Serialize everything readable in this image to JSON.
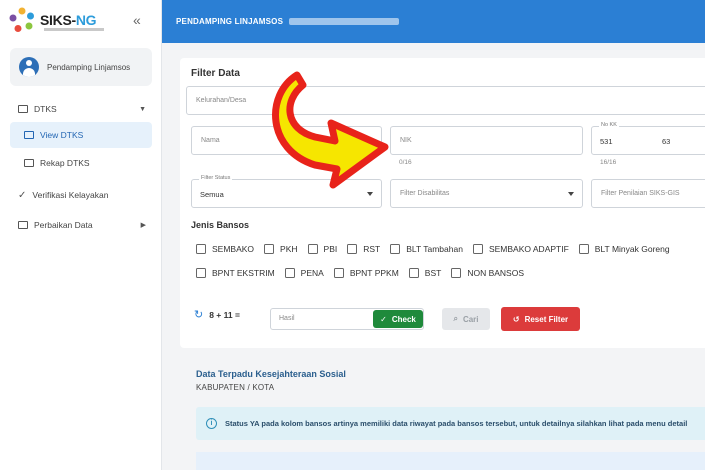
{
  "app": {
    "logo_text": "SIKS-",
    "logo_text_accent": "NG",
    "collapse_glyph": "«",
    "user_role": "Pendamping Linjamsos"
  },
  "sidebar": {
    "items": [
      {
        "label": "DTKS",
        "icon": "table-icon",
        "caret": "▼"
      },
      {
        "label": "View DTKS",
        "icon": "table-icon",
        "active": true
      },
      {
        "label": "Rekap DTKS",
        "icon": "table-icon"
      },
      {
        "label": "Verifikasi Kelayakan",
        "icon": "check-icon"
      },
      {
        "label": "Perbaikan Data",
        "icon": "search-icon",
        "caret": "▶"
      }
    ]
  },
  "header": {
    "title": "PENDAMPING LINJAMSOS"
  },
  "filter": {
    "title": "Filter Data",
    "kelurahan_placeholder": "Kelurahan/Desa",
    "nama_placeholder": "Nama",
    "nik_placeholder": "NIK",
    "nik_counter": "0/16",
    "no_kk_label": "No KK",
    "no_kk_value_a": "531",
    "no_kk_value_b": "63",
    "no_kk_counter": "16/16",
    "status_label": "Filter Status",
    "status_value": "Semua",
    "disabilitas_placeholder": "Filter Disabilitas",
    "penilaian_placeholder": "Filter Penilaian SIKS-GIS"
  },
  "bansos": {
    "title": "Jenis Bansos",
    "row1": [
      "SEMBAKO",
      "PKH",
      "PBI",
      "RST",
      "BLT Tambahan",
      "SEMBAKO ADAPTIF",
      "BLT Minyak Goreng"
    ],
    "row2": [
      "BPNT EKSTRIM",
      "PENA",
      "BPNT PPKM",
      "BST",
      "NON BANSOS"
    ]
  },
  "captcha": {
    "question": "8 + 11 =",
    "placeholder": "Hasil",
    "check_label": "Check",
    "cari_label": "Cari",
    "reset_label": "Reset Filter"
  },
  "section": {
    "title": "Data Terpadu Kesejahteraan Sosial",
    "subtitle": "KABUPATEN / KOTA",
    "info_text": "Status YA pada kolom bansos artinya memiliki data riwayat pada bansos tersebut, untuk detailnya silahkan lihat pada menu detail"
  },
  "colors": {
    "header": "#2b7fd4",
    "check_button": "#1f8a3b",
    "reset_button": "#dc3b3b",
    "annotation_arrow": "#e8231a",
    "annotation_fill": "#f6e600"
  }
}
